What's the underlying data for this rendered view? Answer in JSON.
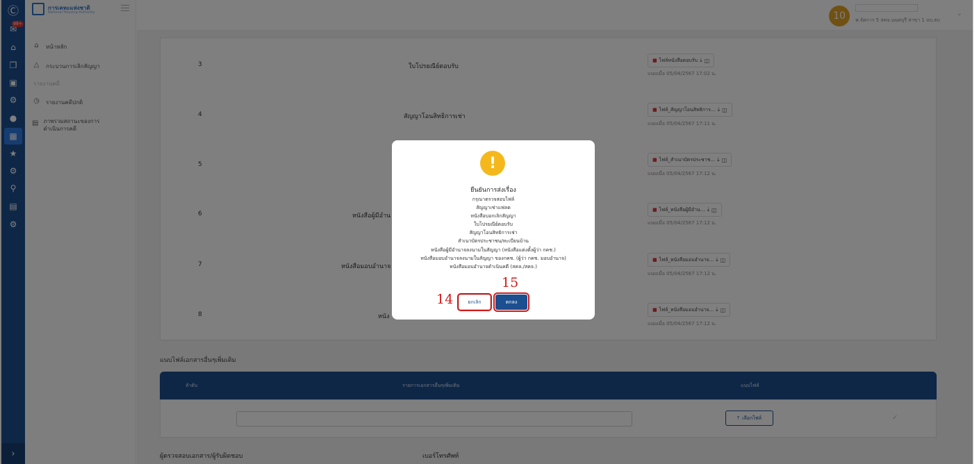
{
  "rail": {
    "badge": "99+",
    "items": [
      "logo",
      "mail",
      "home",
      "copy",
      "document",
      "settings",
      "user",
      "dashboard",
      "team",
      "gear",
      "search",
      "chart",
      "settings-2"
    ]
  },
  "sidebar": {
    "logo_title": "การเคหะแห่งชาติ",
    "logo_subtitle": "National Housing Authority",
    "items": [
      {
        "icon": "home-icon",
        "label": "หน้าหลัก"
      },
      {
        "icon": "contract-icon",
        "label": "กระบวนการเลิกสัญญา"
      }
    ],
    "section_label": "รายงานคดี",
    "report_items": [
      {
        "icon": "clock-icon",
        "label": "รายงานคดีปกติ"
      },
      {
        "icon": "document-icon",
        "label": "ภาพรวมสถานะของการดำเนินการคดี"
      }
    ]
  },
  "header": {
    "avatar_text": "10",
    "user_dept": "พ.จัดการ 5 สคจ.นนทบุรี สาขา 1 บบ.ธบ"
  },
  "rows": [
    {
      "num": "3",
      "name": "ใบโปรยณีย์ตอบรับ",
      "file": "ไฟล์หนังสือตอบรับ",
      "date": "แนบเมื่อ 05/04/2567 17:02 น."
    },
    {
      "num": "4",
      "name": "สัญญาโอนสิทธิการเช่า",
      "file": "ไฟล์_สัญญาโอนสิทธิการ...",
      "date": "แนบเมื่อ 05/04/2567 17:11 น."
    },
    {
      "num": "5",
      "name": "",
      "file": "ไฟล์_สำเนาบัตรประชาช...",
      "date": "แนบเมื่อ 05/04/2567 17:12 น."
    },
    {
      "num": "6",
      "name": "หนังสือผู้มีอำน",
      "file": "ไฟล์_หนังสือผู้มีอำน...",
      "date": "แนบเมื่อ 05/04/2567 17:12 น."
    },
    {
      "num": "7",
      "name": "หนังสือมอบอำนาจ",
      "file": "ไฟล์_หนังสือมอบอำนาจ...",
      "date": "แนบเมื่อ 05/04/2567 17:12 น."
    },
    {
      "num": "8",
      "name": "หนัง",
      "file": "ไฟล์_หนังสือมอบอำนาจ...",
      "date": "แนบเมื่อ 05/04/2567 17:12 น."
    }
  ],
  "extra": {
    "section_title": "แนบไฟล์เอกสารอื่นๆเพิ่มเติม",
    "col_order": "ลำดับ",
    "col_docs": "รายการเอกสารอื่นๆเพิ่มเติม",
    "col_attach": "แนบไฟล์",
    "upload_label": "เลือกไฟล์",
    "footer_reviewer": "ผู้ตรวจสอบเอกสาร/ผู้รับผิดชอบ",
    "footer_phone": "เบอร์โทรศัพท์"
  },
  "modal": {
    "title": "ยืนยันการส่งเรื่อง",
    "lines": [
      "กรุณาตรวจสอบไฟล์",
      "สัญญาเช่าแฟลต",
      "หนังสือบอกเลิกสัญญา",
      "ใบโปรยณีย์ตอบรับ",
      "สัญญาโอนสิทธิการเช่า",
      "สำเนาบัตรประชาชน/ทะเบียนบ้าน",
      "หนังสือผู้มีอำนาจลงนามในสัญญา (หนังสือแต่งตั้งผู้ว่า กคช.)",
      "หนังสือมอบอำนาจลงนามในสัญญา ของกคช. (ผู้ว่า กคช. มอบอำนาจ)",
      "หนังสือมอบอำนาจดำเนินคดี (สคล./สคจ.)"
    ],
    "cancel_label": "ยกเลิก",
    "ok_label": "ตกลง"
  },
  "callouts": {
    "cancel": "14",
    "ok": "15"
  }
}
